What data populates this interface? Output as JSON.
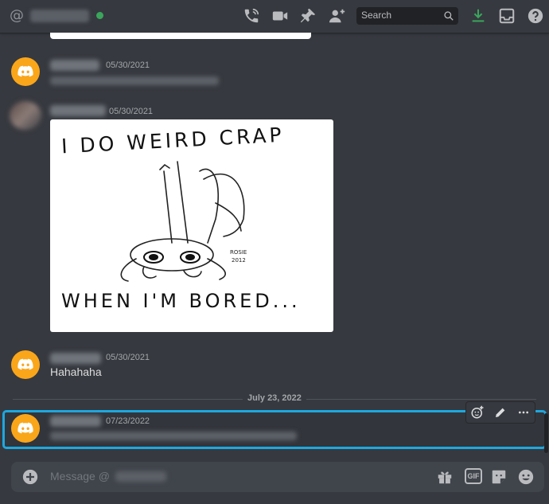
{
  "header": {
    "at_symbol": "@",
    "search_placeholder": "Search",
    "icons": [
      "call-icon",
      "video-icon",
      "pin-icon",
      "add-member-icon",
      "search-icon",
      "download-icon",
      "inbox-icon",
      "help-icon"
    ]
  },
  "messages": [
    {
      "timestamp": "05/30/2021",
      "avatar": "discord-logo"
    },
    {
      "timestamp": "05/30/2021",
      "avatar": "photo",
      "image_text": {
        "line1": "I DO WEIRD CRAP",
        "line2": "WHEN I'M BORED...",
        "signature_name": "ROSIE",
        "signature_year": "2012"
      }
    },
    {
      "timestamp": "05/30/2021",
      "avatar": "discord-logo",
      "text": "Hahahaha"
    },
    {
      "timestamp": "07/23/2022",
      "avatar": "discord-logo",
      "highlighted": true
    }
  ],
  "date_divider": "July 23, 2022",
  "composer": {
    "placeholder": "Message @",
    "icons": [
      "add-icon",
      "gift-icon",
      "gif-icon",
      "sticker-icon",
      "emoji-icon"
    ],
    "gif_label": "GIF"
  },
  "colors": {
    "background": "#36393f",
    "avatar": "#faa61a",
    "highlight": "#1da8e0",
    "online": "#3ba55c",
    "download": "#3ba55c"
  }
}
